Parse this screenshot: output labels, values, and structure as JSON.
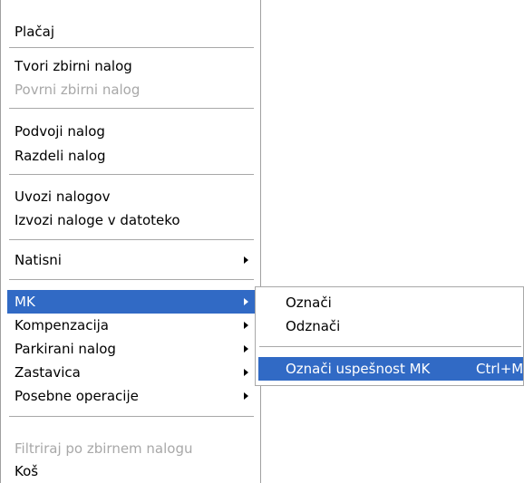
{
  "menu": {
    "items": [
      {
        "label": "Plačaj",
        "disabled": false
      },
      {
        "label": "Tvori zbirni nalog",
        "disabled": false
      },
      {
        "label": "Povrni zbirni nalog",
        "disabled": true
      },
      {
        "label": "Podvoji nalog",
        "disabled": false
      },
      {
        "label": "Razdeli nalog",
        "disabled": false
      },
      {
        "label": "Uvozi nalogov",
        "disabled": false
      },
      {
        "label": "Izvozi naloge v datoteko",
        "disabled": false
      },
      {
        "label": "Natisni",
        "disabled": false,
        "submenu": true
      },
      {
        "label": "MK",
        "disabled": false,
        "submenu": true,
        "selected": true
      },
      {
        "label": "Kompenzacija",
        "disabled": false,
        "submenu": true
      },
      {
        "label": "Parkirani nalog",
        "disabled": false,
        "submenu": true
      },
      {
        "label": "Zastavica",
        "disabled": false,
        "submenu": true
      },
      {
        "label": "Posebne operacije",
        "disabled": false,
        "submenu": true
      },
      {
        "label": "Filtriraj po zbirnem nalogu",
        "disabled": true
      },
      {
        "label": "Koš",
        "disabled": false
      }
    ]
  },
  "submenu": {
    "items": [
      {
        "label": "Označi"
      },
      {
        "label": "Odznači"
      },
      {
        "label": "Označi uspešnost MK",
        "shortcut": "Ctrl+M",
        "selected": true
      }
    ]
  },
  "colors": {
    "highlight": "#316ac5",
    "disabled_text": "#a8a8a8"
  }
}
